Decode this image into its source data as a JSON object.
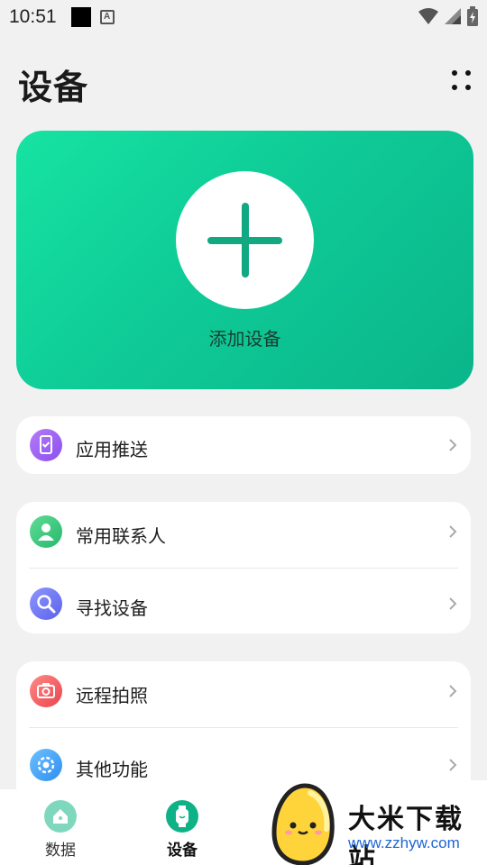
{
  "status": {
    "time": "10:51",
    "a_icon_letter": "A"
  },
  "header": {
    "title": "设备"
  },
  "add_card": {
    "label": "添加设备"
  },
  "groups": [
    {
      "items": [
        {
          "label": "应用推送",
          "icon": "app-push-icon",
          "color": "#9a5cf0"
        }
      ]
    },
    {
      "items": [
        {
          "label": "常用联系人",
          "icon": "contacts-icon",
          "color": "#35c77d"
        },
        {
          "label": "寻找设备",
          "icon": "find-device-icon",
          "color": "#6b74f0"
        }
      ]
    },
    {
      "items": [
        {
          "label": "远程拍照",
          "icon": "remote-camera-icon",
          "color": "#f0595f"
        },
        {
          "label": "其他功能",
          "icon": "other-functions-icon",
          "color": "#3a9ef5"
        }
      ]
    }
  ],
  "bottom_nav": {
    "items": [
      {
        "label": "数据",
        "icon": "home-icon",
        "active": false
      },
      {
        "label": "设备",
        "icon": "watch-icon",
        "active": true
      }
    ]
  },
  "watermark": {
    "title": "大米下载站",
    "url": "www.zzhyw.com"
  },
  "colors": {
    "accent": "#12b886",
    "card_gradient_start": "#16e3a2",
    "card_gradient_end": "#0ab58a",
    "background": "#f1f1f1"
  }
}
